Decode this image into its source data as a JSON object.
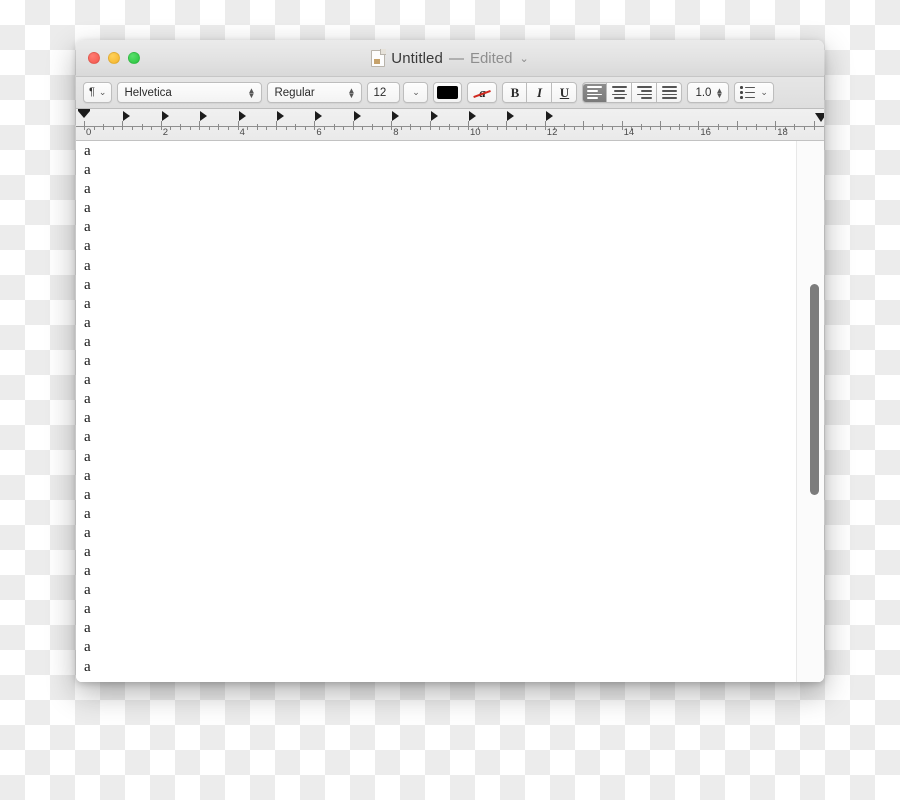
{
  "window": {
    "traffic_lights": [
      {
        "name": "close",
        "color": "#f4564c"
      },
      {
        "name": "minimize",
        "color": "#f5b42a"
      },
      {
        "name": "zoom",
        "color": "#27c33d"
      }
    ],
    "title": "Untitled",
    "title_separator": "—",
    "title_status": "Edited",
    "title_chevron": "⌄",
    "doc_icon": "document-icon"
  },
  "toolbar": {
    "paragraph_style": {
      "glyph": "¶",
      "chevron": "⌄"
    },
    "font_family": {
      "value": "Helvetica",
      "stepper": "⌃⌄"
    },
    "font_style": {
      "value": "Regular",
      "stepper": "⌃⌄"
    },
    "font_size": {
      "value": "12",
      "chevron": "⌄"
    },
    "text_color": {
      "name": "color-swatch",
      "hex": "#000000"
    },
    "highlight": {
      "name": "strikethrough-a",
      "glyph": "a",
      "line_color": "#d0291f"
    },
    "bold": "B",
    "italic": "I",
    "underline": "U",
    "align": [
      {
        "name": "align-left",
        "selected": true
      },
      {
        "name": "align-center",
        "selected": false
      },
      {
        "name": "align-right",
        "selected": false
      },
      {
        "name": "align-justify",
        "selected": false
      }
    ],
    "line_spacing": {
      "value": "1.0",
      "stepper": "⌃⌄"
    },
    "lists": {
      "name": "list-icon",
      "chevron": "⌄"
    }
  },
  "ruler": {
    "unit_labels": [
      "0",
      "2",
      "4",
      "6",
      "8",
      "10",
      "12",
      "14",
      "16",
      "18"
    ],
    "tab_stops": [
      0,
      1,
      2,
      3,
      4,
      5,
      6,
      7,
      8,
      9,
      10,
      11,
      12
    ],
    "left_indent": 0,
    "right_indent": 19.2
  },
  "document": {
    "lines": [
      "a",
      "a",
      "a",
      "a",
      "a",
      "a",
      "a",
      "a",
      "a",
      "a",
      "a",
      "a",
      "a",
      "a",
      "a",
      "a",
      "a",
      "a",
      "a",
      "a",
      "a",
      "a",
      "a",
      "a",
      "a",
      "a",
      "a",
      "a"
    ]
  },
  "scrollbar": {
    "name": "vertical-scrollbar",
    "color": "#7c7c7c"
  }
}
